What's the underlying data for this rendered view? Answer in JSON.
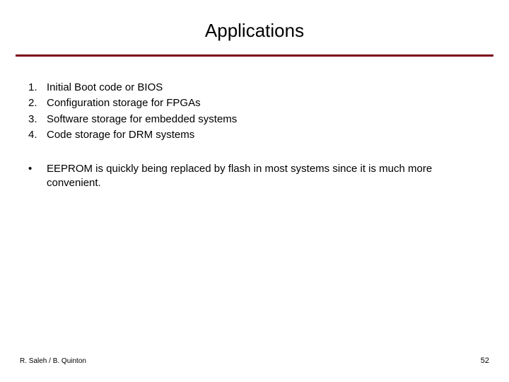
{
  "title": "Applications",
  "items": [
    {
      "num": "1.",
      "text": "Initial Boot code or BIOS"
    },
    {
      "num": "2.",
      "text": "Configuration storage for FPGAs"
    },
    {
      "num": "3.",
      "text": "Software storage for embedded systems"
    },
    {
      "num": "4.",
      "text": "Code storage for DRM systems"
    }
  ],
  "bullet": {
    "mark": "•",
    "text": "EEPROM is quickly being replaced by flash in most systems since it is much more convenient."
  },
  "footer": {
    "authors": "R. Saleh / B. Quinton",
    "page": "52"
  },
  "colors": {
    "rule": "#7a0019"
  }
}
